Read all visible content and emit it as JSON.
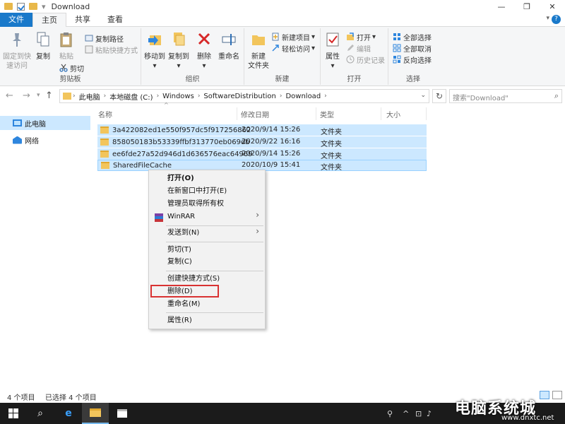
{
  "window": {
    "title": "Download",
    "minimize": "—",
    "maximize": "❐",
    "close": "✕"
  },
  "ribbon_tabs": [
    "文件",
    "主页",
    "共享",
    "查看"
  ],
  "ribbon": {
    "clipboard": {
      "pin_label_1": "固定到快",
      "pin_label_2": "速访问",
      "copy": "复制",
      "paste": "粘贴",
      "copy_path": "复制路径",
      "paste_shortcut": "粘贴快捷方式",
      "cut": "剪切",
      "group": "剪贴板"
    },
    "organize": {
      "move_to": "移动到",
      "copy_to": "复制到",
      "delete": "删除",
      "rename": "重命名",
      "group": "组织"
    },
    "new": {
      "new_folder_1": "新建",
      "new_folder_2": "文件夹",
      "new_item": "新建项目",
      "easy_access": "轻松访问",
      "group": "新建"
    },
    "open": {
      "properties": "属性",
      "open": "打开",
      "edit": "编辑",
      "history": "历史记录",
      "group": "打开"
    },
    "select": {
      "select_all": "全部选择",
      "select_none": "全部取消",
      "invert": "反向选择",
      "group": "选择"
    }
  },
  "address": {
    "crumbs": [
      "此电脑",
      "本地磁盘 (C:)",
      "Windows",
      "SoftwareDistribution",
      "Download"
    ],
    "search_placeholder": "搜索\"Download\""
  },
  "nav": {
    "items": [
      {
        "label": "此电脑"
      },
      {
        "label": "网络"
      }
    ]
  },
  "columns": {
    "name": "名称",
    "modified": "修改日期",
    "type": "类型",
    "size": "大小"
  },
  "files": [
    {
      "name": "3a422082ed1e550f957dc5f917256862",
      "modified": "2020/9/14 15:26",
      "type": "文件夹"
    },
    {
      "name": "858050183b53339ffbf313770eb069db",
      "modified": "2020/9/22 16:16",
      "type": "文件夹"
    },
    {
      "name": "ee6fde27a52d946d1d636576eac64969",
      "modified": "2020/9/14 15:26",
      "type": "文件夹"
    },
    {
      "name": "SharedFileCache",
      "modified": "2020/10/9 15:41",
      "type": "文件夹"
    }
  ],
  "context_menu": {
    "open": "打开(O)",
    "open_new_window": "在新窗口中打开(E)",
    "take_ownership": "管理员取得所有权",
    "winrar": "WinRAR",
    "send_to": "发送到(N)",
    "cut": "剪切(T)",
    "copy": "复制(C)",
    "create_shortcut": "创建快捷方式(S)",
    "delete": "删除(D)",
    "rename": "重命名(M)",
    "properties": "属性(R)"
  },
  "status": {
    "count": "4 个项目",
    "selected": "已选择 4 个项目"
  },
  "watermark": {
    "text": "电脑系统城",
    "url": "www.dnxtc.net"
  }
}
